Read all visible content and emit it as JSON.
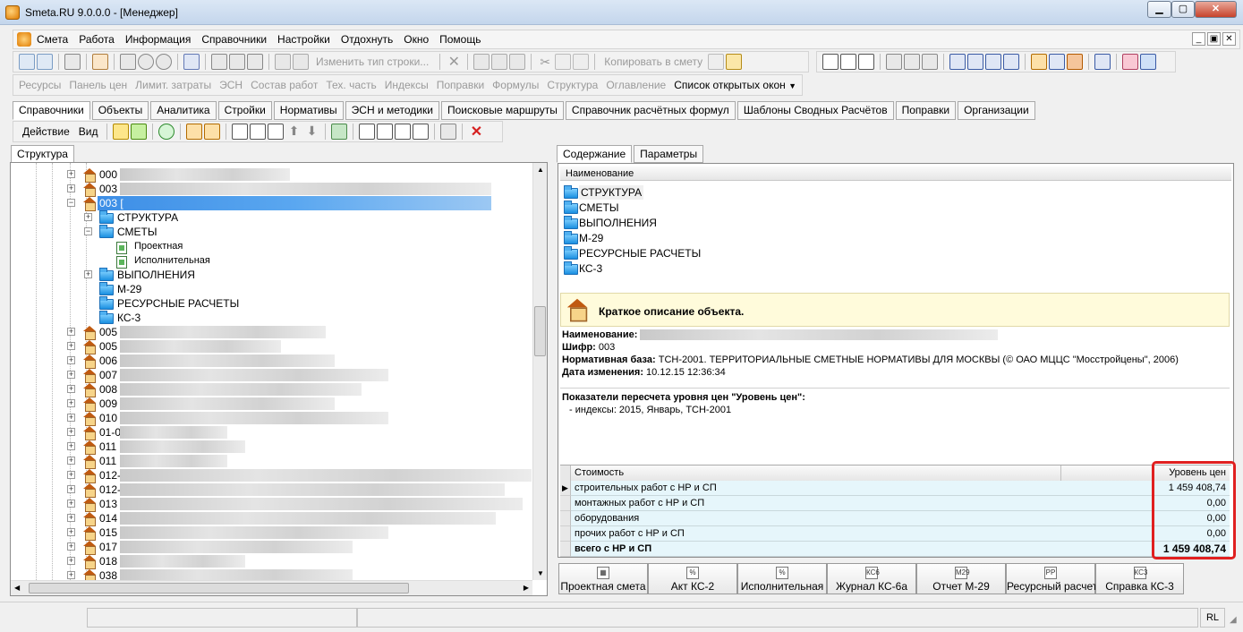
{
  "window": {
    "title": "Smeta.RU  9.0.0.0  - [Менеджер]",
    "min": "▁",
    "max": "▢",
    "close": "✕"
  },
  "menu": [
    "Смета",
    "Работа",
    "Информация",
    "Справочники",
    "Настройки",
    "Отдохнуть",
    "Окно",
    "Помощь"
  ],
  "mdi_buttons": [
    "_",
    "▣",
    "✕"
  ],
  "toolbar1": {
    "change_row_type": "Изменить тип строки...",
    "copy_to_estimate": "Копировать в смету"
  },
  "toolbar2": [
    "Ресурсы",
    "Панель цен",
    "Лимит. затраты",
    "ЭСН",
    "Состав работ",
    "Тех. часть",
    "Индексы",
    "Поправки",
    "Формулы",
    "Структура",
    "Оглавление"
  ],
  "open_windows": "Список открытых окон",
  "ref_tabs": [
    "Справочники",
    "Объекты",
    "Аналитика",
    "Стройки",
    "Нормативы",
    "ЭСН и методики",
    "Поисковые маршруты",
    "Справочник расчётных формул",
    "Шаблоны Сводных Расчётов",
    "Поправки",
    "Организации"
  ],
  "toolbar4": {
    "action": "Действие",
    "view": "Вид"
  },
  "left_tab": "Структура",
  "tree": {
    "top": [
      "000 [",
      "003 ["
    ],
    "selected": "003 [",
    "children": [
      "СТРУКТУРА",
      "СМЕТЫ",
      "Проектная",
      "Исполнительная",
      "ВЫПОЛНЕНИЯ",
      "М-29",
      "РЕСУРСНЫЕ РАСЧЕТЫ",
      "КС-3"
    ],
    "rest": [
      "005",
      "005",
      "006",
      "007",
      "008",
      "009",
      "010",
      "01-0",
      "011",
      "011",
      "012-",
      "012-",
      "013",
      "014",
      "015",
      "017",
      "018",
      "038"
    ]
  },
  "right_tabs": [
    "Содержание",
    "Параметры"
  ],
  "content": {
    "header": "Наименование",
    "items": [
      "СТРУКТУРА",
      "СМЕТЫ",
      "ВЫПОЛНЕНИЯ",
      "М-29",
      "РЕСУРСНЫЕ РАСЧЕТЫ",
      "КС-3"
    ]
  },
  "desc": {
    "title": "Краткое описание объекта.",
    "name_label": "Наименование:",
    "code_label": "Шифр:",
    "code_value": "003",
    "base_label": "Нормативная база:",
    "base_value": "ТСН-2001. ТЕРРИТОРИАЛЬНЫЕ СМЕТНЫЕ НОРМАТИВЫ ДЛЯ МОСКВЫ (© ОАО МЦЦС \"Мосстройцены\", 2006)",
    "date_label": "Дата изменения:",
    "date_value": "10.12.15 12:36:34",
    "indicators_label": "Показатели пересчета уровня цен \"Уровень цен\":",
    "indicators_value": "- индексы: 2015, Январь, ТСН-2001"
  },
  "costs": {
    "col_cost": "Стоимость",
    "col_level": "Уровень цен",
    "rows": [
      {
        "label": "строительных работ с НР и СП",
        "value": "1 459 408,74"
      },
      {
        "label": "монтажных работ с НР и СП",
        "value": "0,00"
      },
      {
        "label": "оборудования",
        "value": "0,00"
      },
      {
        "label": "прочих работ с НР и СП",
        "value": "0,00"
      },
      {
        "label": "всего с НР и СП",
        "value": "1 459 408,74"
      }
    ]
  },
  "bottom_buttons": [
    {
      "label": "Проектная смета",
      "icon": "▦"
    },
    {
      "label": "Акт КС-2",
      "icon": "%"
    },
    {
      "label": "Исполнительная",
      "icon": "%"
    },
    {
      "label": "Журнал КС-6а",
      "icon": "КС6"
    },
    {
      "label": "Отчет М-29",
      "icon": "М29"
    },
    {
      "label": "Ресурсный расчет",
      "icon": "РР"
    },
    {
      "label": "Справка КС-3",
      "icon": "КС3"
    }
  ],
  "status": {
    "lang": "RL"
  }
}
